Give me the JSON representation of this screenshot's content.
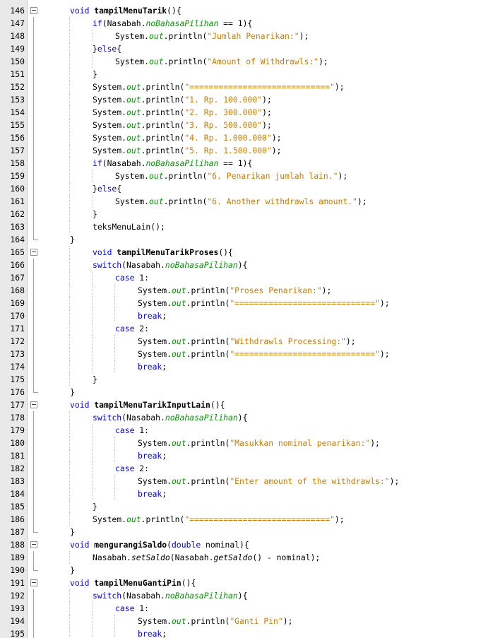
{
  "editor": {
    "lines": [
      {
        "n": "146",
        "indent": 1,
        "fold": "open",
        "tokens": [
          [
            "kw",
            "void"
          ],
          [
            "t",
            " "
          ],
          [
            "b",
            "tampilMenuTarik"
          ],
          [
            "t",
            "(){"
          ]
        ]
      },
      {
        "n": "147",
        "indent": 2,
        "tokens": [
          [
            "kw",
            "if"
          ],
          [
            "t",
            "(Nasabah."
          ],
          [
            "fld",
            "noBahasaPilihan"
          ],
          [
            "t",
            " == 1){"
          ]
        ]
      },
      {
        "n": "148",
        "indent": 3,
        "tokens": [
          [
            "t",
            "System."
          ],
          [
            "fld",
            "out"
          ],
          [
            "t",
            ".println("
          ],
          [
            "str",
            "\"Jumlah Penarikan:\""
          ],
          [
            "t",
            ");"
          ]
        ]
      },
      {
        "n": "149",
        "indent": 2,
        "tokens": [
          [
            "t",
            "}"
          ],
          [
            "kw",
            "else"
          ],
          [
            "t",
            "{"
          ]
        ]
      },
      {
        "n": "150",
        "indent": 3,
        "tokens": [
          [
            "t",
            "System."
          ],
          [
            "fld",
            "out"
          ],
          [
            "t",
            ".println("
          ],
          [
            "str",
            "\"Amount of Withdrawls:\""
          ],
          [
            "t",
            ");"
          ]
        ]
      },
      {
        "n": "151",
        "indent": 2,
        "tokens": [
          [
            "t",
            "}"
          ]
        ]
      },
      {
        "n": "152",
        "indent": 2,
        "tokens": [
          [
            "t",
            "System."
          ],
          [
            "fld",
            "out"
          ],
          [
            "t",
            ".println("
          ],
          [
            "str",
            "\"=============================\""
          ],
          [
            "t",
            ");"
          ]
        ]
      },
      {
        "n": "153",
        "indent": 2,
        "tokens": [
          [
            "t",
            "System."
          ],
          [
            "fld",
            "out"
          ],
          [
            "t",
            ".println("
          ],
          [
            "str",
            "\"1. Rp. 100.000\""
          ],
          [
            "t",
            ");"
          ]
        ]
      },
      {
        "n": "154",
        "indent": 2,
        "tokens": [
          [
            "t",
            "System."
          ],
          [
            "fld",
            "out"
          ],
          [
            "t",
            ".println("
          ],
          [
            "str",
            "\"2. Rp. 300.000\""
          ],
          [
            "t",
            ");"
          ]
        ]
      },
      {
        "n": "155",
        "indent": 2,
        "tokens": [
          [
            "t",
            "System."
          ],
          [
            "fld",
            "out"
          ],
          [
            "t",
            ".println("
          ],
          [
            "str",
            "\"3. Rp. 500.000\""
          ],
          [
            "t",
            ");"
          ]
        ]
      },
      {
        "n": "156",
        "indent": 2,
        "tokens": [
          [
            "t",
            "System."
          ],
          [
            "fld",
            "out"
          ],
          [
            "t",
            ".println("
          ],
          [
            "str",
            "\"4. Rp. 1.000.000\""
          ],
          [
            "t",
            ");"
          ]
        ]
      },
      {
        "n": "157",
        "indent": 2,
        "tokens": [
          [
            "t",
            "System."
          ],
          [
            "fld",
            "out"
          ],
          [
            "t",
            ".println("
          ],
          [
            "str",
            "\"5. Rp. 1.500.000\""
          ],
          [
            "t",
            ");"
          ]
        ]
      },
      {
        "n": "158",
        "indent": 2,
        "tokens": [
          [
            "kw",
            "if"
          ],
          [
            "t",
            "(Nasabah."
          ],
          [
            "fld",
            "noBahasaPilihan"
          ],
          [
            "t",
            " == 1){"
          ]
        ]
      },
      {
        "n": "159",
        "indent": 3,
        "tokens": [
          [
            "t",
            "System."
          ],
          [
            "fld",
            "out"
          ],
          [
            "t",
            ".println("
          ],
          [
            "str",
            "\"6. Penarikan jumlah lain.\""
          ],
          [
            "t",
            ");"
          ]
        ]
      },
      {
        "n": "160",
        "indent": 2,
        "tokens": [
          [
            "t",
            "}"
          ],
          [
            "kw",
            "else"
          ],
          [
            "t",
            "{"
          ]
        ]
      },
      {
        "n": "161",
        "indent": 3,
        "tokens": [
          [
            "t",
            "System."
          ],
          [
            "fld",
            "out"
          ],
          [
            "t",
            ".println("
          ],
          [
            "str",
            "\"6. Another withdrawls amount.\""
          ],
          [
            "t",
            ");"
          ]
        ]
      },
      {
        "n": "162",
        "indent": 2,
        "tokens": [
          [
            "t",
            "}"
          ]
        ]
      },
      {
        "n": "163",
        "indent": 2,
        "tokens": [
          [
            "t",
            "teksMenuLain();"
          ]
        ]
      },
      {
        "n": "164",
        "indent": 1,
        "fold": "end",
        "tokens": [
          [
            "t",
            "}"
          ]
        ]
      },
      {
        "n": "165",
        "indent": 2,
        "fold": "open",
        "tokens": [
          [
            "kw",
            "void"
          ],
          [
            "t",
            " "
          ],
          [
            "b",
            "tampilMenuTarikProses"
          ],
          [
            "t",
            "(){"
          ]
        ]
      },
      {
        "n": "166",
        "indent": 2,
        "tokens": [
          [
            "kw",
            "switch"
          ],
          [
            "t",
            "(Nasabah."
          ],
          [
            "fld",
            "noBahasaPilihan"
          ],
          [
            "t",
            "){"
          ]
        ]
      },
      {
        "n": "167",
        "indent": 3,
        "tokens": [
          [
            "kw",
            "case"
          ],
          [
            "t",
            " 1:"
          ]
        ]
      },
      {
        "n": "168",
        "indent": 4,
        "tokens": [
          [
            "t",
            "System."
          ],
          [
            "fld",
            "out"
          ],
          [
            "t",
            ".println("
          ],
          [
            "str",
            "\"Proses Penarikan:\""
          ],
          [
            "t",
            ");"
          ]
        ]
      },
      {
        "n": "169",
        "indent": 4,
        "tokens": [
          [
            "t",
            "System."
          ],
          [
            "fld",
            "out"
          ],
          [
            "t",
            ".println("
          ],
          [
            "str",
            "\"=============================\""
          ],
          [
            "t",
            ");"
          ]
        ]
      },
      {
        "n": "170",
        "indent": 4,
        "tokens": [
          [
            "kw",
            "break"
          ],
          [
            "t",
            ";"
          ]
        ]
      },
      {
        "n": "171",
        "indent": 3,
        "tokens": [
          [
            "kw",
            "case"
          ],
          [
            "t",
            " 2:"
          ]
        ]
      },
      {
        "n": "172",
        "indent": 4,
        "tokens": [
          [
            "t",
            "System."
          ],
          [
            "fld",
            "out"
          ],
          [
            "t",
            ".println("
          ],
          [
            "str",
            "\"Withdrawls Processing:\""
          ],
          [
            "t",
            ");"
          ]
        ]
      },
      {
        "n": "173",
        "indent": 4,
        "tokens": [
          [
            "t",
            "System."
          ],
          [
            "fld",
            "out"
          ],
          [
            "t",
            ".println("
          ],
          [
            "str",
            "\"=============================\""
          ],
          [
            "t",
            ");"
          ]
        ]
      },
      {
        "n": "174",
        "indent": 4,
        "tokens": [
          [
            "kw",
            "break"
          ],
          [
            "t",
            ";"
          ]
        ]
      },
      {
        "n": "175",
        "indent": 2,
        "tokens": [
          [
            "t",
            "}"
          ]
        ]
      },
      {
        "n": "176",
        "indent": 1,
        "fold": "end",
        "tokens": [
          [
            "t",
            "}"
          ]
        ]
      },
      {
        "n": "177",
        "indent": 1,
        "fold": "open",
        "tokens": [
          [
            "kw",
            "void"
          ],
          [
            "t",
            " "
          ],
          [
            "b",
            "tampilMenuTarikInputLain"
          ],
          [
            "t",
            "(){"
          ]
        ]
      },
      {
        "n": "178",
        "indent": 2,
        "tokens": [
          [
            "kw",
            "switch"
          ],
          [
            "t",
            "(Nasabah."
          ],
          [
            "fld",
            "noBahasaPilihan"
          ],
          [
            "t",
            "){"
          ]
        ]
      },
      {
        "n": "179",
        "indent": 3,
        "tokens": [
          [
            "kw",
            "case"
          ],
          [
            "t",
            " 1:"
          ]
        ]
      },
      {
        "n": "180",
        "indent": 4,
        "tokens": [
          [
            "t",
            "System."
          ],
          [
            "fld",
            "out"
          ],
          [
            "t",
            ".println("
          ],
          [
            "str",
            "\"Masukkan nominal penarikan:\""
          ],
          [
            "t",
            ");"
          ]
        ]
      },
      {
        "n": "181",
        "indent": 4,
        "tokens": [
          [
            "kw",
            "break"
          ],
          [
            "t",
            ";"
          ]
        ]
      },
      {
        "n": "182",
        "indent": 3,
        "tokens": [
          [
            "kw",
            "case"
          ],
          [
            "t",
            " 2:"
          ]
        ]
      },
      {
        "n": "183",
        "indent": 4,
        "tokens": [
          [
            "t",
            "System."
          ],
          [
            "fld",
            "out"
          ],
          [
            "t",
            ".println("
          ],
          [
            "str",
            "\"Enter amount of the withdrawls:\""
          ],
          [
            "t",
            ");"
          ]
        ]
      },
      {
        "n": "184",
        "indent": 4,
        "tokens": [
          [
            "kw",
            "break"
          ],
          [
            "t",
            ";"
          ]
        ]
      },
      {
        "n": "185",
        "indent": 2,
        "tokens": [
          [
            "t",
            "}"
          ]
        ]
      },
      {
        "n": "186",
        "indent": 2,
        "tokens": [
          [
            "t",
            "System."
          ],
          [
            "fld",
            "out"
          ],
          [
            "t",
            ".println("
          ],
          [
            "str",
            "\"=============================\""
          ],
          [
            "t",
            ");"
          ]
        ]
      },
      {
        "n": "187",
        "indent": 1,
        "fold": "end",
        "tokens": [
          [
            "t",
            "}"
          ]
        ]
      },
      {
        "n": "188",
        "indent": 1,
        "fold": "open",
        "tokens": [
          [
            "kw",
            "void"
          ],
          [
            "t",
            " "
          ],
          [
            "b",
            "mengurangiSaldo"
          ],
          [
            "t",
            "("
          ],
          [
            "kw",
            "double"
          ],
          [
            "t",
            " nominal){"
          ]
        ]
      },
      {
        "n": "189",
        "indent": 2,
        "tokens": [
          [
            "t",
            "Nasabah."
          ],
          [
            "smt",
            "setSaldo"
          ],
          [
            "t",
            "(Nasabah."
          ],
          [
            "smt",
            "getSaldo"
          ],
          [
            "t",
            "() - nominal);"
          ]
        ]
      },
      {
        "n": "190",
        "indent": 1,
        "fold": "end",
        "tokens": [
          [
            "t",
            "}"
          ]
        ]
      },
      {
        "n": "191",
        "indent": 1,
        "fold": "open",
        "tokens": [
          [
            "kw",
            "void"
          ],
          [
            "t",
            " "
          ],
          [
            "b",
            "tampilMenuGantiPin"
          ],
          [
            "t",
            "(){"
          ]
        ]
      },
      {
        "n": "192",
        "indent": 2,
        "tokens": [
          [
            "kw",
            "switch"
          ],
          [
            "t",
            "(Nasabah."
          ],
          [
            "fld",
            "noBahasaPilihan"
          ],
          [
            "t",
            "){"
          ]
        ]
      },
      {
        "n": "193",
        "indent": 3,
        "tokens": [
          [
            "kw",
            "case"
          ],
          [
            "t",
            " 1:"
          ]
        ]
      },
      {
        "n": "194",
        "indent": 4,
        "tokens": [
          [
            "t",
            "System."
          ],
          [
            "fld",
            "out"
          ],
          [
            "t",
            ".println("
          ],
          [
            "str",
            "\"Ganti Pin\""
          ],
          [
            "t",
            ");"
          ]
        ]
      },
      {
        "n": "195",
        "indent": 4,
        "tokens": [
          [
            "kw",
            "break"
          ],
          [
            "t",
            ";"
          ]
        ]
      }
    ]
  }
}
